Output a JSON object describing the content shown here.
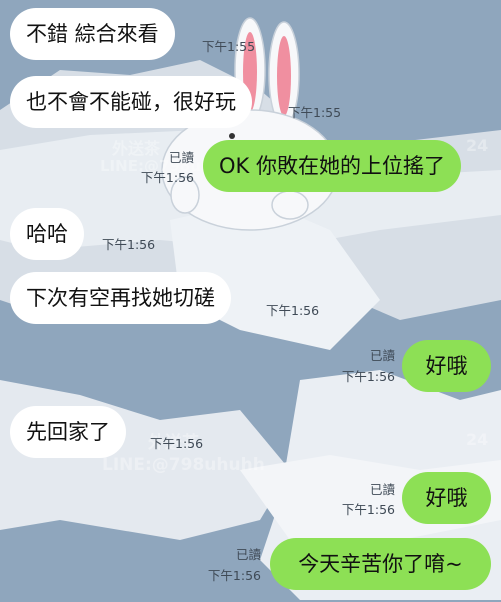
{
  "colors": {
    "background": "#8fa6bd",
    "incoming_bubble": "#ffffff",
    "outgoing_bubble": "#8de055",
    "meta_text": "#3f4a56"
  },
  "watermark": {
    "line1": "外送茶",
    "line2": "LINE:@798uhuhh",
    "side": "24"
  },
  "messages": [
    {
      "dir": "in",
      "text": "不錯 綜合來看",
      "time": "下午1:55"
    },
    {
      "dir": "in",
      "text": "也不會不能碰，很好玩",
      "time": "下午1:55"
    },
    {
      "dir": "out",
      "text": "OK 你敗在她的上位搖了",
      "read": "已讀",
      "time": "下午1:56"
    },
    {
      "dir": "in",
      "text": "哈哈",
      "time": "下午1:56"
    },
    {
      "dir": "in",
      "text": "下次有空再找她切磋",
      "time": "下午1:56"
    },
    {
      "dir": "out",
      "text": "好哦",
      "read": "已讀",
      "time": "下午1:56"
    },
    {
      "dir": "in",
      "text": "先回家了",
      "time": "下午1:56"
    },
    {
      "dir": "out",
      "text": "好哦",
      "read": "已讀",
      "time": "下午1:56"
    },
    {
      "dir": "out",
      "text": "今天辛苦你了唷~",
      "read": "已讀",
      "time": "下午1:56"
    }
  ]
}
